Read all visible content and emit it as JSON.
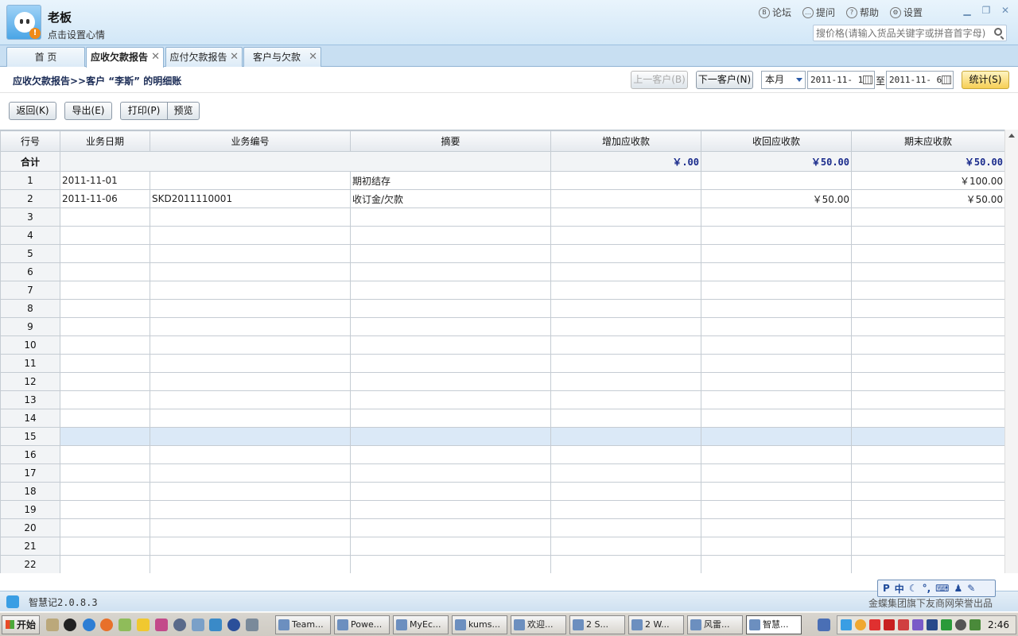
{
  "header": {
    "user_name": "老板",
    "mood": "点击设置心情",
    "links": [
      "论坛",
      "提问",
      "帮助",
      "设置"
    ],
    "link_icons": [
      "bbs-icon",
      "question-icon",
      "help-icon",
      "gear-icon"
    ],
    "search_placeholder": "搜价格(请输入货品关键字或拼音首字母)"
  },
  "tabs": [
    {
      "label": "首  页",
      "closable": false
    },
    {
      "label": "应收欠款报告",
      "closable": true,
      "active": true
    },
    {
      "label": "应付欠款报告",
      "closable": true
    },
    {
      "label": "客户与欠款",
      "closable": true
    }
  ],
  "report": {
    "breadcrumb": "应收欠款报告>>客户 “李斯” 的明细账",
    "prev_customer": "上一客户(B)",
    "next_customer": "下一客户(N)",
    "period": "本月",
    "date_from": "2011-11- 1",
    "to_label": "至",
    "date_to": "2011-11- 6",
    "stat_button": "统计(S)"
  },
  "actions": {
    "back": "返回(K)",
    "export": "导出(E)",
    "print": "打印(P)",
    "preview": "预览"
  },
  "grid": {
    "columns": [
      "行号",
      "业务日期",
      "业务编号",
      "摘要",
      "增加应收款",
      "收回应收款",
      "期末应收款"
    ],
    "total": {
      "label": "合计",
      "increase": "￥.00",
      "recover": "￥50.00",
      "ending": "￥50.00"
    },
    "rows": [
      {
        "no": "1",
        "date": "2011-11-01",
        "code": "",
        "summary": "期初结存",
        "increase": "",
        "recover": "",
        "ending": "￥100.00"
      },
      {
        "no": "2",
        "date": "2011-11-06",
        "code": "SKD2011110001",
        "summary": "收订金/欠款",
        "increase": "",
        "recover": "￥50.00",
        "ending": "￥50.00"
      },
      {
        "no": "3"
      },
      {
        "no": "4"
      },
      {
        "no": "5"
      },
      {
        "no": "6"
      },
      {
        "no": "7"
      },
      {
        "no": "8"
      },
      {
        "no": "9"
      },
      {
        "no": "10"
      },
      {
        "no": "11"
      },
      {
        "no": "12"
      },
      {
        "no": "13"
      },
      {
        "no": "14"
      },
      {
        "no": "15",
        "selected": true
      },
      {
        "no": "16"
      },
      {
        "no": "17"
      },
      {
        "no": "18"
      },
      {
        "no": "19"
      },
      {
        "no": "20"
      },
      {
        "no": "21"
      },
      {
        "no": "22"
      }
    ]
  },
  "status": {
    "version": "智慧记2.0.8.3",
    "footer_note": "金蝶集团旗下友商网荣誉出品",
    "ime": "中"
  },
  "taskbar": {
    "start": "开始",
    "tasks": [
      "Team...",
      "Powe...",
      "MyEc...",
      "kums...",
      "欢迎...",
      "2 S...",
      "2 W...",
      "风雷...",
      "智慧..."
    ],
    "active_task": "智慧...",
    "clock": "2:46"
  },
  "colors": {
    "accent": "#2a5aa8",
    "header_bg": "#d2e7f7",
    "total_text": "#1a2b8c",
    "stat_button": "#f6cf55"
  }
}
